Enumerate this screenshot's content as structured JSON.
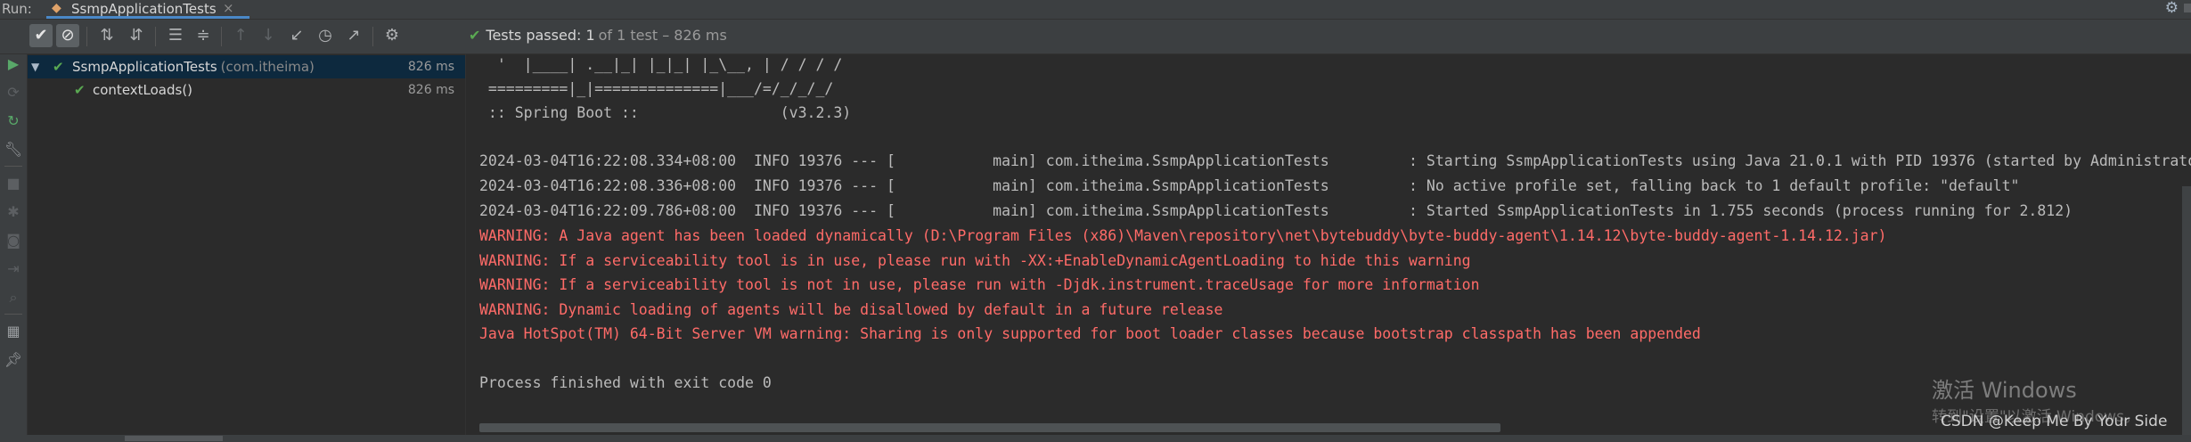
{
  "run_bar": {
    "label": "Run:",
    "tab_label": "SsmpApplicationTests",
    "tab_close": "×"
  },
  "toolbar": {
    "status_main": "Tests passed: 1",
    "status_count": "of 1 test – 826 ms"
  },
  "test_tree": [
    {
      "name": "SsmpApplicationTests",
      "package": "(com.itheima)",
      "time": "826 ms",
      "expanded": true
    },
    {
      "name": "contextLoads()",
      "package": "",
      "time": "826 ms"
    }
  ],
  "console": {
    "lines": [
      {
        "text": "  '  |____| .__|_| |_|_| |_\\__, | / / / /",
        "type": "normal"
      },
      {
        "text": " =========|_|==============|___/=/_/_/_/",
        "type": "normal"
      },
      {
        "text": " :: Spring Boot ::                (v3.2.3)",
        "type": "normal"
      },
      {
        "text": "",
        "type": "normal"
      },
      {
        "text": "2024-03-04T16:22:08.334+08:00  INFO 19376 --- [           main] com.itheima.SsmpApplicationTests         : Starting SsmpApplicationTests using Java 21.0.1 with PID 19376 (started by Administrator",
        "type": "normal"
      },
      {
        "text": "2024-03-04T16:22:08.336+08:00  INFO 19376 --- [           main] com.itheima.SsmpApplicationTests         : No active profile set, falling back to 1 default profile: \"default\"",
        "type": "normal"
      },
      {
        "text": "2024-03-04T16:22:09.786+08:00  INFO 19376 --- [           main] com.itheima.SsmpApplicationTests         : Started SsmpApplicationTests in 1.755 seconds (process running for 2.812)",
        "type": "normal"
      },
      {
        "text": "WARNING: A Java agent has been loaded dynamically (D:\\Program Files (x86)\\Maven\\repository\\net\\bytebuddy\\byte-buddy-agent\\1.14.12\\byte-buddy-agent-1.14.12.jar)",
        "type": "warn"
      },
      {
        "text": "WARNING: If a serviceability tool is in use, please run with -XX:+EnableDynamicAgentLoading to hide this warning",
        "type": "warn"
      },
      {
        "text": "WARNING: If a serviceability tool is not in use, please run with -Djdk.instrument.traceUsage for more information",
        "type": "warn"
      },
      {
        "text": "WARNING: Dynamic loading of agents will be disallowed by default in a future release",
        "type": "warn"
      },
      {
        "text": "Java HotSpot(TM) 64-Bit Server VM warning: Sharing is only supported for boot loader classes because bootstrap classpath has been appended",
        "type": "warn"
      },
      {
        "text": "",
        "type": "normal"
      },
      {
        "text": "Process finished with exit code 0",
        "type": "normal"
      }
    ]
  },
  "watermark": {
    "windows_title": "激活 Windows",
    "windows_sub": "转到\"设置\"以激活 Windows。",
    "csdn": "CSDN @Keep Me By Your Side"
  },
  "colors": {
    "background": "#2b2b2b",
    "panel": "#3c3f41",
    "success_green": "#5aa952",
    "warning_red": "#ff6b68",
    "selection": "#0d293e",
    "tab_underline": "#4a88c7"
  },
  "icons": {
    "toolbar": [
      "show-passed-icon",
      "show-ignored-icon",
      "sort-alpha-icon",
      "sort-duration-icon",
      "expand-all-icon",
      "collapse-all-icon",
      "prev-failed-icon",
      "next-failed-icon",
      "import-tests-icon",
      "history-icon",
      "export-icon",
      "settings-icon"
    ],
    "sidebar": [
      "run-icon",
      "rerun-failed-icon",
      "rerun-icon",
      "wrench-icon",
      "stop-icon",
      "debug-icon",
      "camera-icon",
      "login-icon",
      "search-icon",
      "layout-icon",
      "pin-icon"
    ]
  }
}
